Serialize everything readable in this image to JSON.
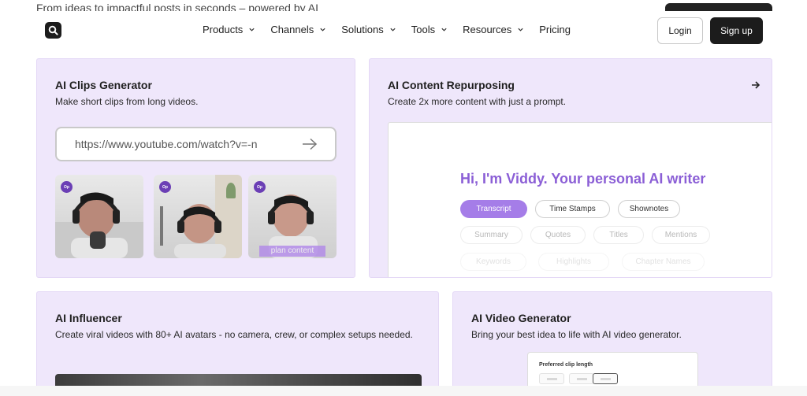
{
  "background": {
    "tagline": "From ideas to impactful posts in seconds – powered by AI"
  },
  "nav": {
    "links": [
      {
        "label": "Products",
        "dropdown": true
      },
      {
        "label": "Channels",
        "dropdown": true
      },
      {
        "label": "Solutions",
        "dropdown": true
      },
      {
        "label": "Tools",
        "dropdown": true
      },
      {
        "label": "Resources",
        "dropdown": true
      },
      {
        "label": "Pricing",
        "dropdown": false
      }
    ],
    "login_label": "Login",
    "signup_label": "Sign up",
    "logo_icon": "magnifier-icon"
  },
  "cards": {
    "clips": {
      "title": "AI Clips Generator",
      "desc": "Make short clips from long videos.",
      "url_placeholder": "https://www.youtube.com/watch?v=-n",
      "thumb_badge": "Op",
      "thumb_caption": "plan content"
    },
    "repurposing": {
      "title": "AI Content Repurposing",
      "desc": "Create 2x more content with just a prompt.",
      "viddy_title": "Hi, I'm Viddy. Your personal AI writer",
      "pills_row1": [
        "Transcript",
        "Time Stamps",
        "Shownotes"
      ],
      "pills_row2": [
        "Summary",
        "Quotes",
        "Titles",
        "Mentions"
      ],
      "pills_row3": [
        "Keywords",
        "Highlights",
        "Chapter Names"
      ]
    },
    "influencer": {
      "title": "AI Influencer",
      "desc": "Create viral videos with 80+ AI avatars - no camera, crew, or complex setups needed."
    },
    "video": {
      "title": "AI Video Generator",
      "desc": "Bring your best idea to life with AI video generator.",
      "pref_label": "Preferred clip length"
    }
  },
  "colors": {
    "card_bg": "#efe7fb",
    "accent": "#a57de8",
    "viddy": "#8b5fd6",
    "dark": "#1c1c1c"
  }
}
